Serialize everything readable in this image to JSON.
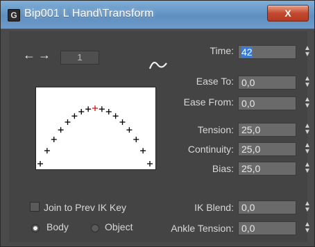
{
  "window": {
    "title": "Bip001 L Hand\\Transform",
    "close_label": "X"
  },
  "nav": {
    "key_number": "1"
  },
  "fields": {
    "time": {
      "label": "Time:",
      "value": "42"
    },
    "ease_to": {
      "label": "Ease To:",
      "value": "0,0"
    },
    "ease_from": {
      "label": "Ease From:",
      "value": "0,0"
    },
    "tension": {
      "label": "Tension:",
      "value": "25,0"
    },
    "continuity": {
      "label": "Continuity:",
      "value": "25,0"
    },
    "bias": {
      "label": "Bias:",
      "value": "25,0"
    },
    "ik_blend": {
      "label": "IK Blend:",
      "value": "0,0"
    },
    "ankle_tension": {
      "label": "Ankle Tension:",
      "value": "0,0"
    }
  },
  "options": {
    "join_prev_ik": {
      "label": "Join to Prev IK Key",
      "checked": false
    },
    "body": {
      "label": "Body",
      "selected": true
    },
    "object": {
      "label": "Object",
      "selected": false
    }
  },
  "colors": {
    "accent_selection": "#3d7bd1",
    "curve_marker": "#000000",
    "highlight_marker": "#e01010"
  }
}
